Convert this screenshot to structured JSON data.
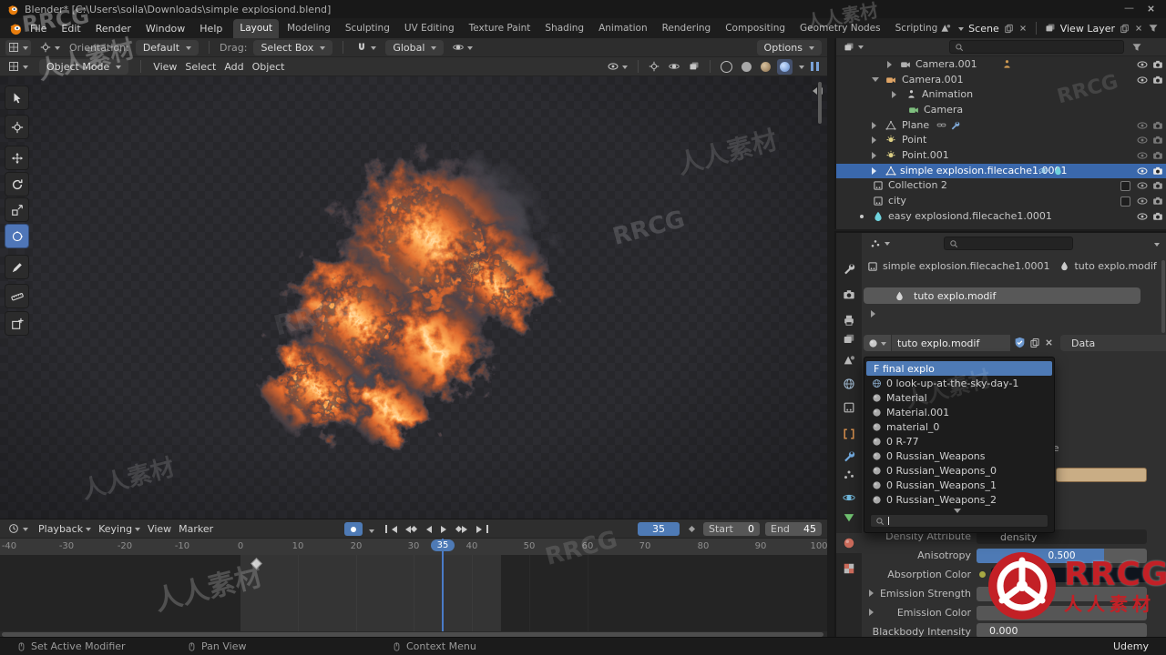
{
  "window": {
    "title": "Blender* [C:\\Users\\soila\\Downloads\\simple explosiond.blend]",
    "minimize": "—"
  },
  "topbar": {
    "menus": [
      "File",
      "Edit",
      "Render",
      "Window",
      "Help"
    ],
    "workspaces": [
      "Layout",
      "Modeling",
      "Sculpting",
      "UV Editing",
      "Texture Paint",
      "Shading",
      "Animation",
      "Rendering",
      "Compositing",
      "Geometry Nodes",
      "Scripting"
    ],
    "active_workspace": "Layout",
    "add_tab": "+",
    "scene": "Scene",
    "view_layer": "View Layer"
  },
  "tool_settings": {
    "orientation_label": "Orientation:",
    "orientation_value": "Default",
    "drag_label": "Drag:",
    "drag_value": "Select Box",
    "pivot": "Global",
    "options": "Options"
  },
  "viewport": {
    "mode": "Object Mode",
    "menus": [
      "View",
      "Select",
      "Add",
      "Object"
    ]
  },
  "outliner": {
    "rows": [
      {
        "label": "Camera.001"
      },
      {
        "label": "Camera.001"
      },
      {
        "label": "Animation"
      },
      {
        "label": "Camera"
      },
      {
        "label": "Plane"
      },
      {
        "label": "Point"
      },
      {
        "label": "Point.001"
      },
      {
        "label": "simple explosion.filecache1.0001",
        "selected": true
      },
      {
        "label": "Collection 2"
      },
      {
        "label": "city"
      },
      {
        "label": "easy explosiond.filecache1.0001"
      }
    ]
  },
  "properties": {
    "breadcrumb_object": "simple explosion.filecache1.0001",
    "breadcrumb_modifier": "tuto explo.modif",
    "name_field": "tuto explo.modif",
    "id_field": "tuto explo.modif",
    "data_tab": "Data",
    "dropdown_items": [
      "F final explo",
      "0 look-up-at-the-sky-day-1",
      "Material",
      "Material.001",
      "material_0",
      "0 R-77",
      "0 Russian_Weapons",
      "0 Russian_Weapons_0",
      "0 Russian_Weapons_1",
      "0 Russian_Weapons_2"
    ],
    "fields": {
      "name_fragment": "me",
      "density_label": "Density Attribute",
      "density_value": "density",
      "anisotropy_label": "Anisotropy",
      "anisotropy_value": "0.500",
      "absorption_label": "Absorption Color",
      "emission_strength_label": "Emission Strength",
      "emission_color_label": "Emission Color",
      "blackbody_label": "Blackbody Intensity",
      "blackbody_value": "0.000"
    }
  },
  "timeline": {
    "menus": [
      "Playback",
      "Keying",
      "View",
      "Marker"
    ],
    "current_frame": "35",
    "start_label": "Start",
    "start_value": "0",
    "end_label": "End",
    "end_value": "45",
    "ticks": [
      "-40",
      "-30",
      "-20",
      "-10",
      "0",
      "10",
      "20",
      "30",
      "40",
      "50",
      "60",
      "70",
      "80",
      "90",
      "100"
    ]
  },
  "status_bar": {
    "hint_left": "Set Active Modifier",
    "hint_middle": "Pan View",
    "hint_right": "Context Menu",
    "brand": "Udemy"
  },
  "watermark": {
    "latin": "RRCG",
    "cn": "人人素材"
  },
  "logo": {
    "brand": "RRCG",
    "brand_cn": "人人素材"
  },
  "colors": {
    "accent": "#4772b3",
    "selection": "#3a68ac",
    "fire": "#e06a2e",
    "logo_red": "#c32026"
  },
  "icons": {
    "search-icon": "magnifier (circle + handle)",
    "funnel-icon": "filter funnel",
    "eye-icon": "visibility eye",
    "camera-icon": "camera body + lens",
    "close-icon": "x cross",
    "chevron-down-icon": "small down triangle",
    "disclosure-triangle-icon": "right/down triangle",
    "wrench-icon": "modifier wrench",
    "sphere-icon": "material sphere",
    "droplet-icon": "fluid droplet",
    "magnet-icon": "snap magnet",
    "mouse-icon": "mouse button hint",
    "keyframe-diamond-icon": "rotated square"
  }
}
